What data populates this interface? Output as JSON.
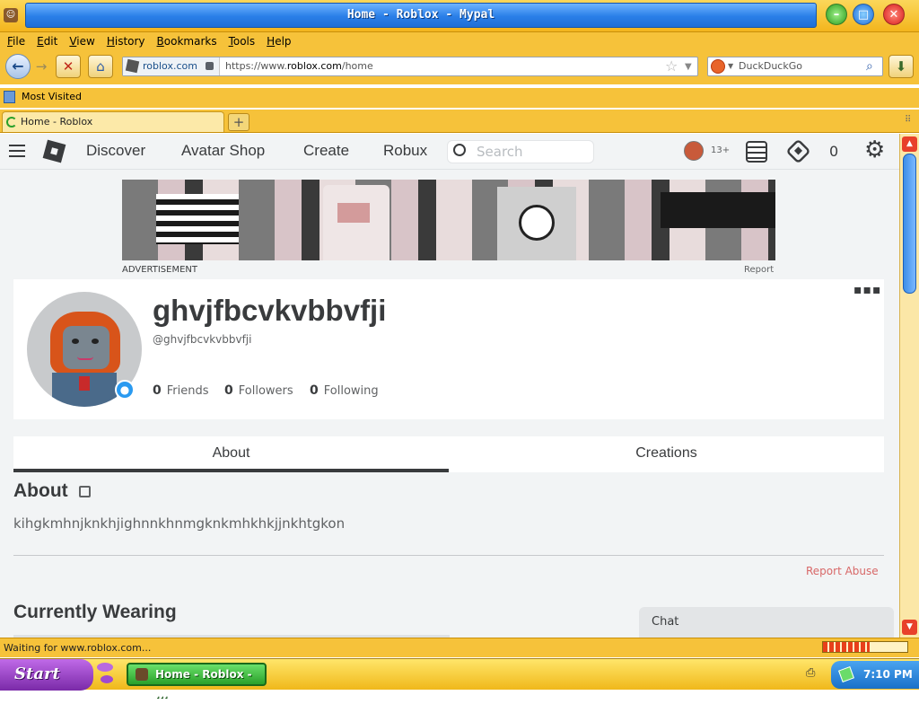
{
  "window": {
    "title": "Home - Roblox - Mypal"
  },
  "menu": [
    "File",
    "Edit",
    "View",
    "History",
    "Bookmarks",
    "Tools",
    "Help"
  ],
  "nav": {
    "site_label": "roblox.com",
    "url_prefix": "https://www.",
    "url_domain": "roblox.com",
    "url_path": "/home",
    "search_engine": "DuckDuckGo"
  },
  "bookmarks": {
    "most_visited": "Most Visited"
  },
  "tabs": [
    {
      "label": "Home - Roblox"
    }
  ],
  "roblox": {
    "nav_links": [
      "Discover",
      "Avatar Shop",
      "Create",
      "Robux"
    ],
    "search_placeholder": "Search",
    "age_badge": "13+",
    "robux_count": "0",
    "ad_label": "ADVERTISEMENT",
    "ad_report": "Report",
    "profile": {
      "display_name": "ghvjfbcvkvbbvfji",
      "username": "@ghvjfbcvkvbbvfji",
      "stats": [
        {
          "count": "0",
          "label": "Friends"
        },
        {
          "count": "0",
          "label": "Followers"
        },
        {
          "count": "0",
          "label": "Following"
        }
      ]
    },
    "tabs": [
      "About",
      "Creations"
    ],
    "about_heading": "About",
    "about_text": "kihgkmhnjknkhjighnnkhnmgknkmhkhkjjnkhtgkon",
    "report_abuse": "Report Abuse",
    "currently_wearing": "Currently Wearing",
    "chat": "Chat"
  },
  "status": {
    "text": "Waiting for www.roblox.com...",
    "progress": 0.55
  },
  "taskbar": {
    "start": "Start",
    "task": "Home - Roblox - ...",
    "clock": "7:10 PM"
  },
  "colors": {
    "accent_yellow": "#f6c23a",
    "title_blue": "#2a7fe8",
    "roblox_text": "#393b3d",
    "report_red": "#d86868"
  }
}
